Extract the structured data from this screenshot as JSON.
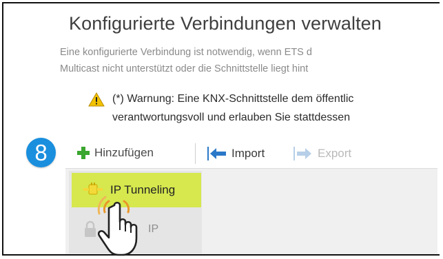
{
  "dialog": {
    "title": "Konfigurierte Verbindungen verwalten",
    "description_line1": "Eine konfigurierte Verbindung ist notwendig, wenn ETS d",
    "description_line2": "Multicast nicht unterstützt oder die Schnittstelle liegt hint",
    "warning_line1": "(*) Warnung: Eine KNX-Schnittstelle dem öffentlic",
    "warning_line2": "verantwortungsvoll und erlauben Sie stattdessen"
  },
  "step_badge": "8",
  "toolbar": {
    "add_label": "Hinzufügen",
    "import_label": "Import",
    "export_label": "Export"
  },
  "connections": [
    {
      "label": "IP Tunneling",
      "icon": "plug-icon",
      "selected": true
    },
    {
      "label": "IP",
      "icon": "lock-icon",
      "selected": false
    }
  ],
  "colors": {
    "highlight": "#d6e84e",
    "badge": "#1a8fde",
    "add_icon": "#3aa62f",
    "import_icon": "#2a78c8",
    "warning_icon": "#e8b400"
  }
}
